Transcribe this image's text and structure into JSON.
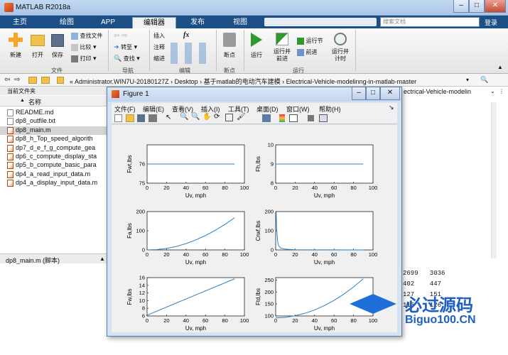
{
  "window": {
    "title": "MATLAB R2018a"
  },
  "tabs": [
    "主页",
    "绘图",
    "APP",
    "编辑器",
    "发布",
    "视图"
  ],
  "search": {
    "placeholder": "搜索文档"
  },
  "login": "登录",
  "ribbon": {
    "file": {
      "new": "新建",
      "open": "打开",
      "save": "保存",
      "find_files": "查找文件",
      "compare": "比较",
      "print": "打印",
      "group": "文件"
    },
    "nav": {
      "goto": "转至",
      "find": "查找",
      "group": "导航"
    },
    "edit": {
      "insert": "插入",
      "comment": "注释",
      "indent": "缩进",
      "fx": "fx",
      "group": "编辑"
    },
    "breakpoints": {
      "label": "断点",
      "group": "断点"
    },
    "run": {
      "run": "运行",
      "run_advance": "运行并前进",
      "run_section": "运行节",
      "advance": "前进",
      "run_time": "运行并计时",
      "group": "运行"
    }
  },
  "address": {
    "path": "« Administrator.WIN7U-20180127Z  ›  Desktop  ›  基于matlab的电动汽车建模  ›  Electrical-Vehicle-modelinng-in-matlab-master"
  },
  "left_panel": {
    "title": "当前文件夹",
    "col_name": "名称",
    "col_sort": "▲",
    "files": [
      "README.md",
      "dp8_outfile.txt",
      "dp8_main.m",
      "dp8_h_Top_speed_algorith",
      "dp7_d_e_f_g_compute_gea",
      "dp6_c_compute_display_sta",
      "dp5_b_compute_basic_para",
      "dp4_a_read_input_data.m",
      "dp4_a_display_input_data.m"
    ],
    "selected": "dp8_main.m",
    "status": "dp8_main.m  (脚本)"
  },
  "right_panel": {
    "snippet": "ectrical-Vehicle-modelin"
  },
  "command": {
    "rows": [
      "2699   3036",
      "402    447",
      "127    151",
      "115    126"
    ]
  },
  "figure": {
    "title": "Figure 1",
    "menu": [
      "文件(F)",
      "编辑(E)",
      "查看(V)",
      "插入(I)",
      "工具(T)",
      "桌面(D)",
      "窗口(W)",
      "帮助(H)"
    ]
  },
  "chart_data": [
    {
      "type": "line",
      "xlabel": "Uv, mph",
      "ylabel": "Fwt,lbs",
      "xlim": [
        0,
        100
      ],
      "ylim": [
        75,
        77
      ],
      "xticks": [
        0,
        20,
        40,
        60,
        80,
        100
      ],
      "yticks": [
        75,
        76
      ],
      "series": [
        {
          "x": [
            0,
            90
          ],
          "y": [
            76,
            76
          ]
        }
      ]
    },
    {
      "type": "line",
      "xlabel": "Uv, mph",
      "ylabel": "Fh,lbs",
      "xlim": [
        0,
        100
      ],
      "ylim": [
        8,
        10
      ],
      "xticks": [
        0,
        20,
        40,
        60,
        80,
        100
      ],
      "yticks": [
        8,
        9,
        10
      ],
      "series": [
        {
          "x": [
            0,
            90
          ],
          "y": [
            9,
            9
          ]
        }
      ]
    },
    {
      "type": "line",
      "xlabel": "Uv, mph",
      "ylabel": "Fa,lbs",
      "xlim": [
        0,
        100
      ],
      "ylim": [
        0,
        200
      ],
      "xticks": [
        0,
        20,
        40,
        60,
        80,
        100
      ],
      "yticks": [
        0,
        100,
        200
      ],
      "series": [
        {
          "x": [
            0,
            10,
            20,
            30,
            40,
            50,
            60,
            70,
            80,
            90
          ],
          "y": [
            0,
            2,
            8,
            18,
            33,
            52,
            75,
            102,
            133,
            168
          ]
        }
      ]
    },
    {
      "type": "line",
      "xlabel": "Uv, mph",
      "ylabel": "Crwf,lbs",
      "xlim": [
        0,
        100
      ],
      "ylim": [
        0,
        200
      ],
      "xticks": [
        0,
        20,
        40,
        60,
        80,
        100
      ],
      "yticks": [
        0,
        100,
        200
      ],
      "series": [
        {
          "x": [
            0.5,
            1,
            2,
            3,
            5,
            10,
            20,
            90
          ],
          "y": [
            200,
            110,
            45,
            22,
            10,
            4,
            1,
            0
          ]
        }
      ]
    },
    {
      "type": "line",
      "xlabel": "Uv, mph",
      "ylabel": "Fw,lbs",
      "xlim": [
        0,
        100
      ],
      "ylim": [
        6,
        16
      ],
      "xticks": [
        0,
        20,
        40,
        60,
        80,
        100
      ],
      "yticks": [
        6,
        8,
        10,
        12,
        14,
        16
      ],
      "series": [
        {
          "x": [
            0,
            90
          ],
          "y": [
            6.2,
            15.7
          ]
        }
      ]
    },
    {
      "type": "line",
      "xlabel": "Uv, mph",
      "ylabel": "Ftd,lbs",
      "xlim": [
        0,
        100
      ],
      "ylim": [
        100,
        260
      ],
      "xticks": [
        0,
        20,
        40,
        60,
        80,
        100
      ],
      "yticks": [
        100,
        150,
        200,
        250
      ],
      "series": [
        {
          "x": [
            0,
            10,
            20,
            30,
            40,
            50,
            60,
            70,
            80,
            90
          ],
          "y": [
            92,
            94,
            101,
            111,
            125,
            143,
            165,
            191,
            221,
            255
          ]
        }
      ]
    }
  ],
  "watermark": {
    "cn": "必过源码",
    "url": "Biguo100.CN"
  }
}
